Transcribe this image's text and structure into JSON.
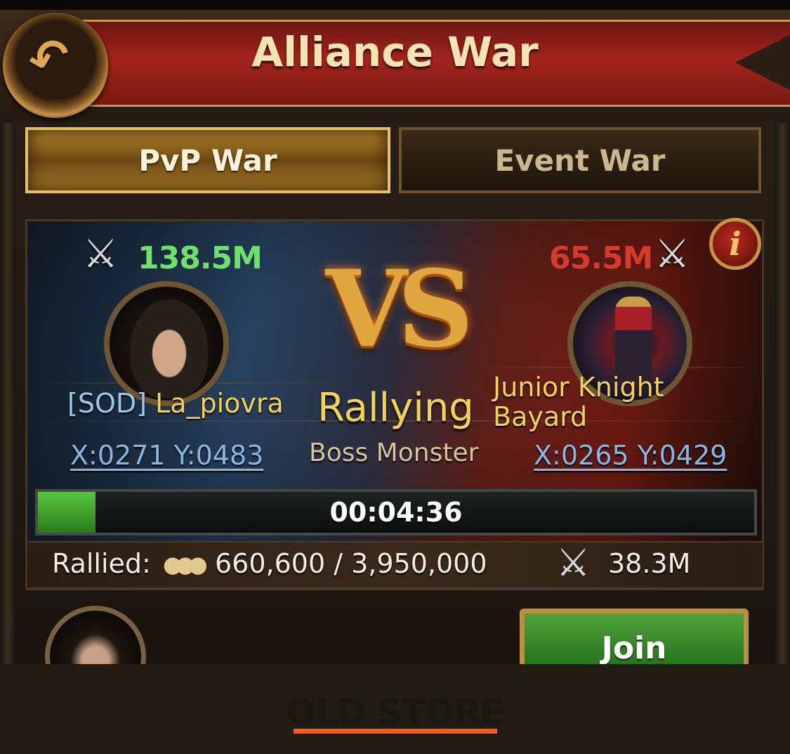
{
  "header": {
    "title": "Alliance War",
    "back_icon": "back-arrow-icon"
  },
  "tabs": [
    {
      "label": "PvP War",
      "active": true
    },
    {
      "label": "Event War",
      "active": false
    }
  ],
  "war": {
    "attacker": {
      "power": "138.5M",
      "tag": "[SOD]",
      "name": "La_piovra",
      "coords": "X:0271 Y:0483"
    },
    "defender": {
      "power": "65.5M",
      "name_line1": "Junior Knight",
      "name_line2": "Bayard",
      "coords": "X:0265 Y:0429"
    },
    "vs": "VS",
    "status": "Rallying",
    "target_type": "Boss Monster",
    "info_icon": "i",
    "timer": "00:04:36",
    "progress_fraction": 0.08
  },
  "rally": {
    "label": "Rallied:",
    "count": "660,600 / 3,950,000",
    "power": "38.3M"
  },
  "actions": {
    "join_label": "Join"
  },
  "footer": {
    "text": "OLD STORE"
  },
  "colors": {
    "attacker_power": "#6fe06b",
    "defender_power": "#d63a2a",
    "name_gold": "#f2d25a",
    "coord_blue": "#8ab6e4",
    "accent_orange": "#ff5a14"
  }
}
